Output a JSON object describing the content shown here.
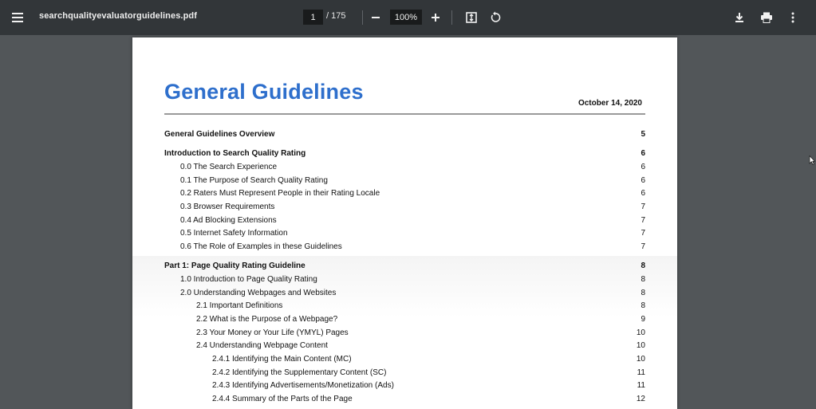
{
  "toolbar": {
    "filename": "searchqualityevaluatorguidelines.pdf",
    "page_current": "1",
    "page_total": "/ 175",
    "zoom": "100%",
    "icons": [
      "menu-icon",
      "zoom-out-icon",
      "zoom-in-icon",
      "fit-page-icon",
      "rotate-icon",
      "download-icon",
      "print-icon",
      "more-vert-icon"
    ]
  },
  "document": {
    "title": "General Guidelines",
    "date": "October 14, 2020",
    "toc": [
      {
        "label": "General Guidelines Overview",
        "page": "5",
        "level": 0,
        "bold": true
      },
      {
        "label": "Introduction to Search Quality Rating",
        "page": "6",
        "level": 0,
        "bold": true
      },
      {
        "label": "0.0 The Search Experience",
        "page": "6",
        "level": 1,
        "bold": false
      },
      {
        "label": "0.1 The Purpose of Search Quality Rating",
        "page": "6",
        "level": 1,
        "bold": false
      },
      {
        "label": "0.2 Raters Must Represent People in their Rating Locale",
        "page": "6",
        "level": 1,
        "bold": false
      },
      {
        "label": "0.3 Browser Requirements",
        "page": "7",
        "level": 1,
        "bold": false
      },
      {
        "label": "0.4 Ad Blocking Extensions",
        "page": "7",
        "level": 1,
        "bold": false
      },
      {
        "label": "0.5 Internet Safety Information",
        "page": "7",
        "level": 1,
        "bold": false
      },
      {
        "label": "0.6 The Role of Examples in these Guidelines",
        "page": "7",
        "level": 1,
        "bold": false
      },
      {
        "label": "Part 1: Page Quality Rating Guideline",
        "page": "8",
        "level": 0,
        "bold": true
      },
      {
        "label": "1.0 Introduction to Page Quality Rating",
        "page": "8",
        "level": 1,
        "bold": false
      },
      {
        "label": "2.0 Understanding Webpages and Websites",
        "page": "8",
        "level": 1,
        "bold": false
      },
      {
        "label": "2.1 Important Definitions",
        "page": "8",
        "level": 2,
        "bold": false
      },
      {
        "label": "2.2 What is the Purpose of a Webpage?",
        "page": "9",
        "level": 2,
        "bold": false
      },
      {
        "label": "2.3 Your Money or Your Life (YMYL) Pages",
        "page": "10",
        "level": 2,
        "bold": false
      },
      {
        "label": "2.4 Understanding Webpage Content",
        "page": "10",
        "level": 2,
        "bold": false
      },
      {
        "label": "2.4.1 Identifying the Main Content (MC)",
        "page": "10",
        "level": 3,
        "bold": false
      },
      {
        "label": "2.4.2 Identifying the Supplementary Content (SC)",
        "page": "11",
        "level": 3,
        "bold": false
      },
      {
        "label": "2.4.3 Identifying Advertisements/Monetization (Ads)",
        "page": "11",
        "level": 3,
        "bold": false
      },
      {
        "label": "2.4.4 Summary of the Parts of the Page",
        "page": "12",
        "level": 3,
        "bold": false
      }
    ]
  }
}
